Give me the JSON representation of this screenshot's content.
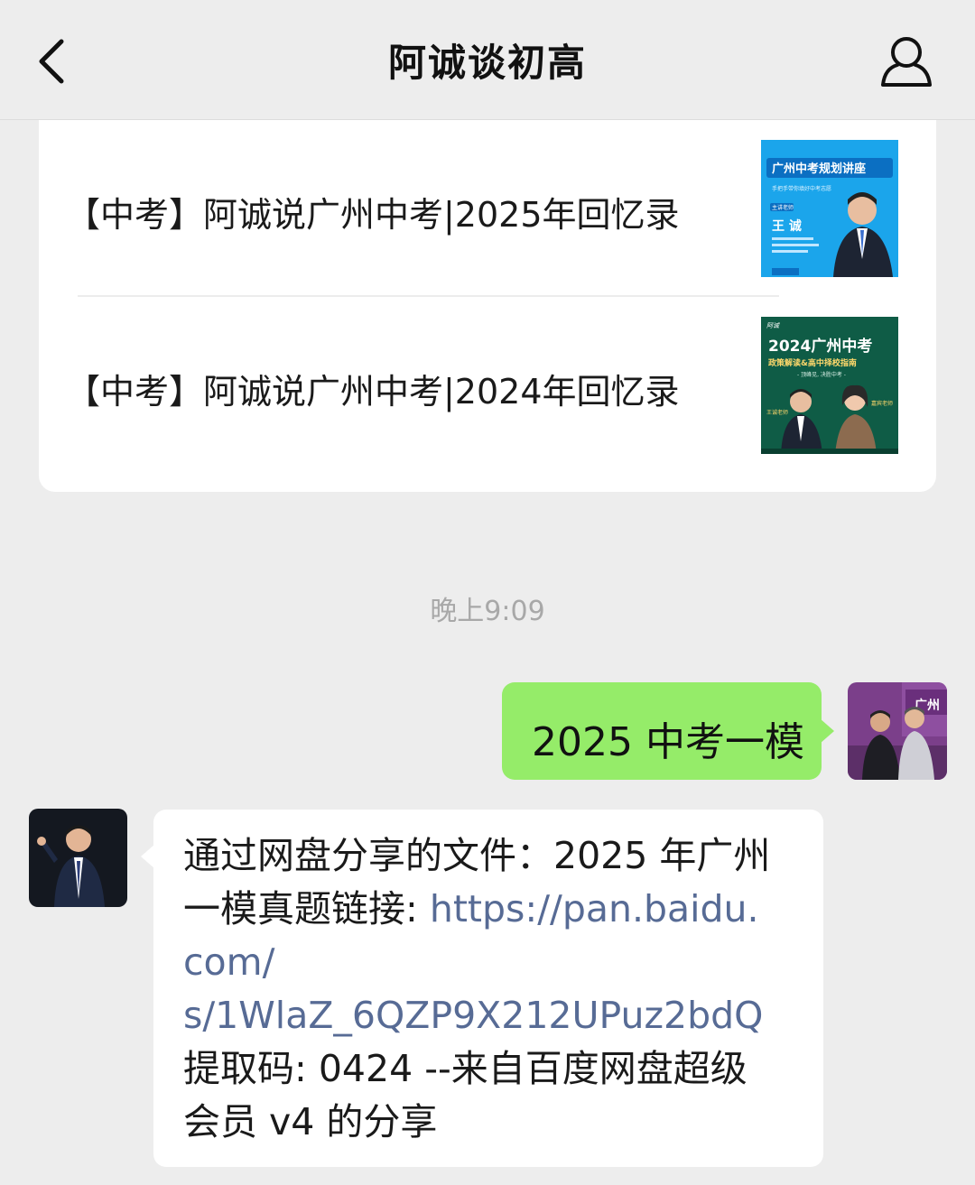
{
  "header": {
    "title": "阿诚谈初高",
    "back_icon": "chevron-left-icon",
    "profile_icon": "person-icon"
  },
  "articles": [
    {
      "title": "【中考】阿诚说广州中考|2025年回忆录",
      "thumbnail": {
        "heading": "广州中考规划讲座",
        "sub": "手把手带你填好中考志愿",
        "speaker_tag": "主讲老师",
        "speaker": "王 诚",
        "accent": "#1a9ee8"
      }
    },
    {
      "title": "【中考】阿诚说广州中考|2024年回忆录",
      "thumbnail": {
        "brand": "阿诚",
        "heading": "2024广州中考",
        "sub": "政策解读&高中择校指南",
        "tagline": "- 顶峰见, 决胜中考 -",
        "speaker_a": "王诚老师",
        "speaker_b": "嘉宾老师",
        "accent": "#0f5c46"
      }
    }
  ],
  "timestamp": "晚上9:09",
  "messages": {
    "sent": {
      "text": "2025 中考一模",
      "avatar_caption": "广州",
      "bubble_color": "#95ec69"
    },
    "received": {
      "lines": [
        {
          "text": "通过网盘分享的文件：2025 年广州",
          "link": ""
        },
        {
          "text": "一模真题链接: ",
          "link": "https://pan.baidu."
        },
        {
          "text": "",
          "link": "com/"
        },
        {
          "text": "",
          "link": "s/1WlaZ_6QZP9X212UPuz2bdQ"
        },
        {
          "text": "提取码: 0424 --来自百度网盘超级",
          "link": ""
        },
        {
          "text": "会员 v4 的分享",
          "link": ""
        }
      ],
      "link_color": "#576b95"
    }
  }
}
